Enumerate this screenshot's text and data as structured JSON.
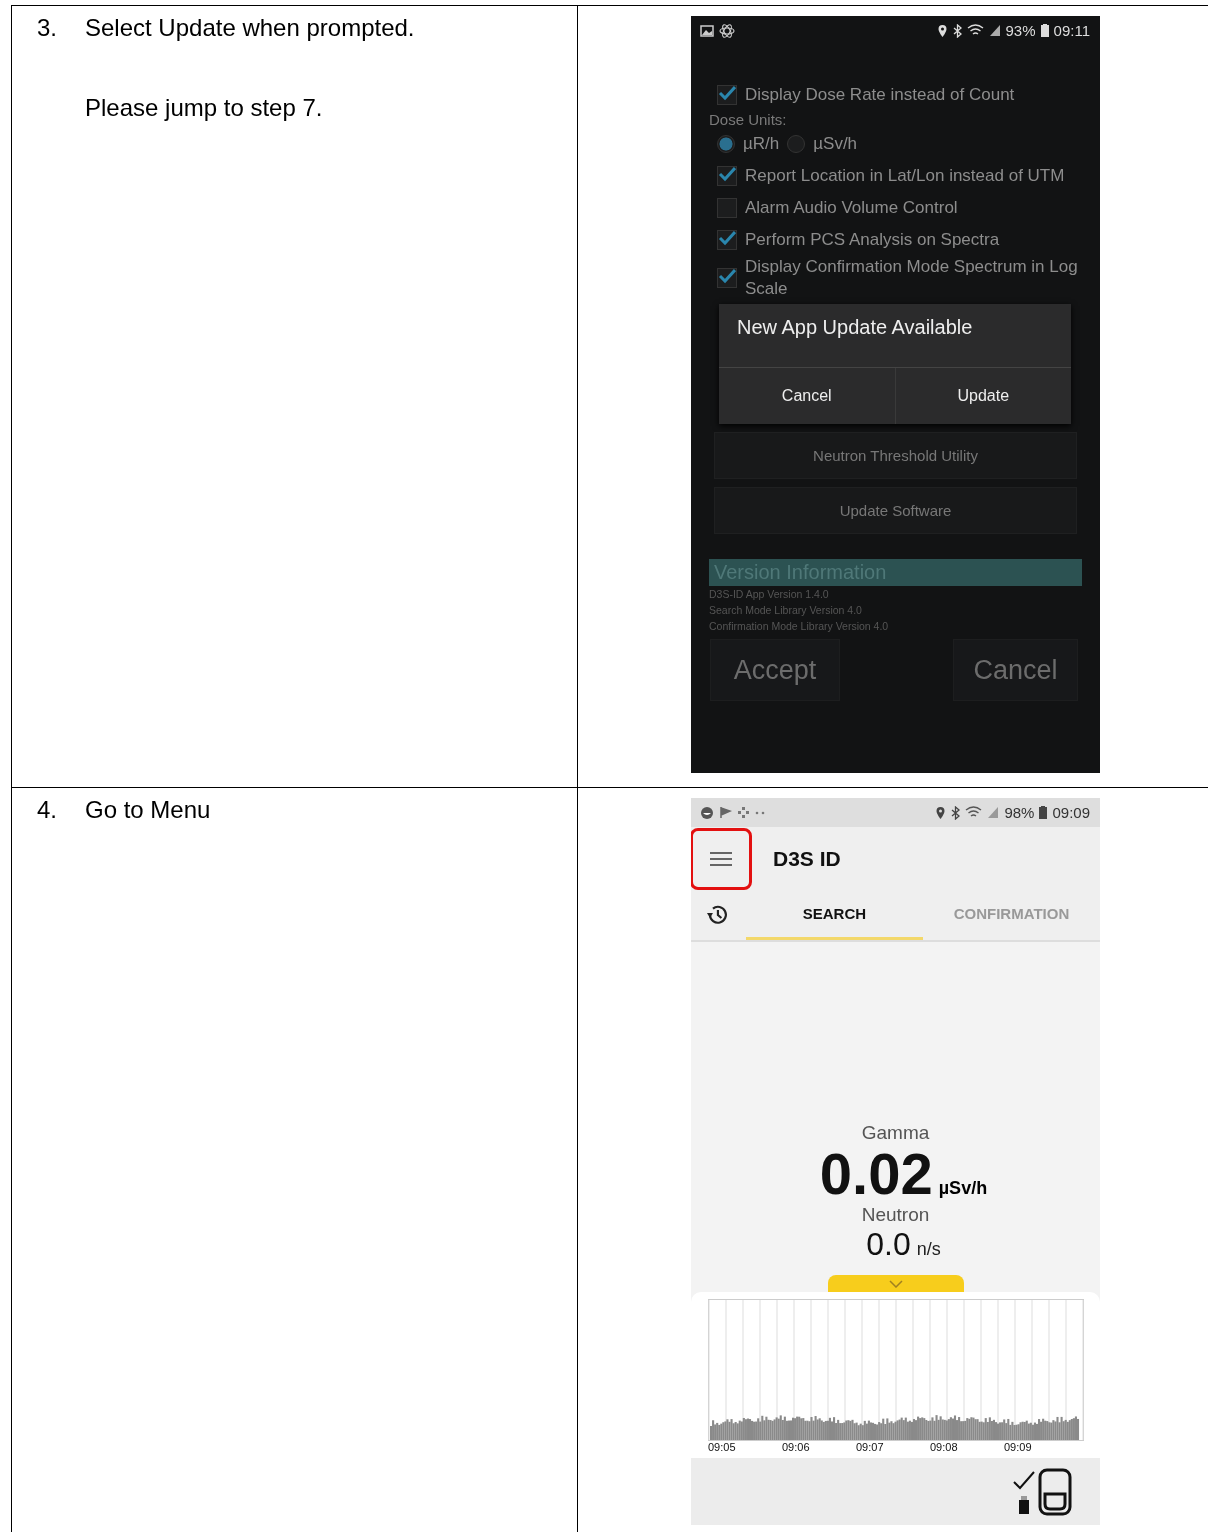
{
  "rows": [
    {
      "number": "3.",
      "instruction": "Select Update when prompted.",
      "note": "Please jump to step 7."
    },
    {
      "number": "4.",
      "instruction": "Go to Menu"
    }
  ],
  "settings_screen": {
    "status_bar": {
      "battery": "93%",
      "time": "09:11"
    },
    "settings": [
      {
        "kind": "checkbox",
        "label": "Display Dose Rate instead of Count",
        "checked": true
      },
      {
        "kind": "heading",
        "label": "Dose Units:"
      },
      {
        "kind": "radio",
        "options": [
          {
            "label": "µR/h",
            "selected": true
          },
          {
            "label": "µSv/h",
            "selected": false
          }
        ]
      },
      {
        "kind": "checkbox",
        "label": "Report Location in Lat/Lon instead of UTM",
        "checked": true
      },
      {
        "kind": "checkbox",
        "label": "Alarm Audio Volume Control",
        "checked": false
      },
      {
        "kind": "checkbox",
        "label": "Perform PCS Analysis on Spectra",
        "checked": true
      },
      {
        "kind": "checkbox",
        "label": "Display Confirmation Mode Spectrum in Log Scale",
        "checked": true
      }
    ],
    "dialog": {
      "title": "New App Update Available",
      "buttons": [
        "Cancel",
        "Update"
      ]
    },
    "tools": [
      "Neutron Threshold Utility",
      "Update Software"
    ],
    "version": {
      "title": "Version Information",
      "lines": [
        "D3S-ID App Version 1.4.0",
        "Search Mode Library Version 4.0",
        "Confirmation Mode Library Version 4.0"
      ]
    },
    "footer_buttons": [
      "Accept",
      "Cancel"
    ]
  },
  "main_screen": {
    "status_bar": {
      "battery": "98%",
      "time": "09:09"
    },
    "menu_button": {
      "highlighted": true
    },
    "title": "D3S ID",
    "tabs": [
      {
        "label": "SEARCH",
        "selected": true
      },
      {
        "label": "CONFIRMATION",
        "selected": false
      }
    ],
    "gamma": {
      "label": "Gamma",
      "value": "0.02",
      "unit": "µSv/h"
    },
    "neutron": {
      "label": "Neutron",
      "value": "0.0",
      "unit": "n/s"
    },
    "time_labels": [
      "09:05",
      "09:06",
      "09:07",
      "09:08",
      "09:09"
    ]
  }
}
